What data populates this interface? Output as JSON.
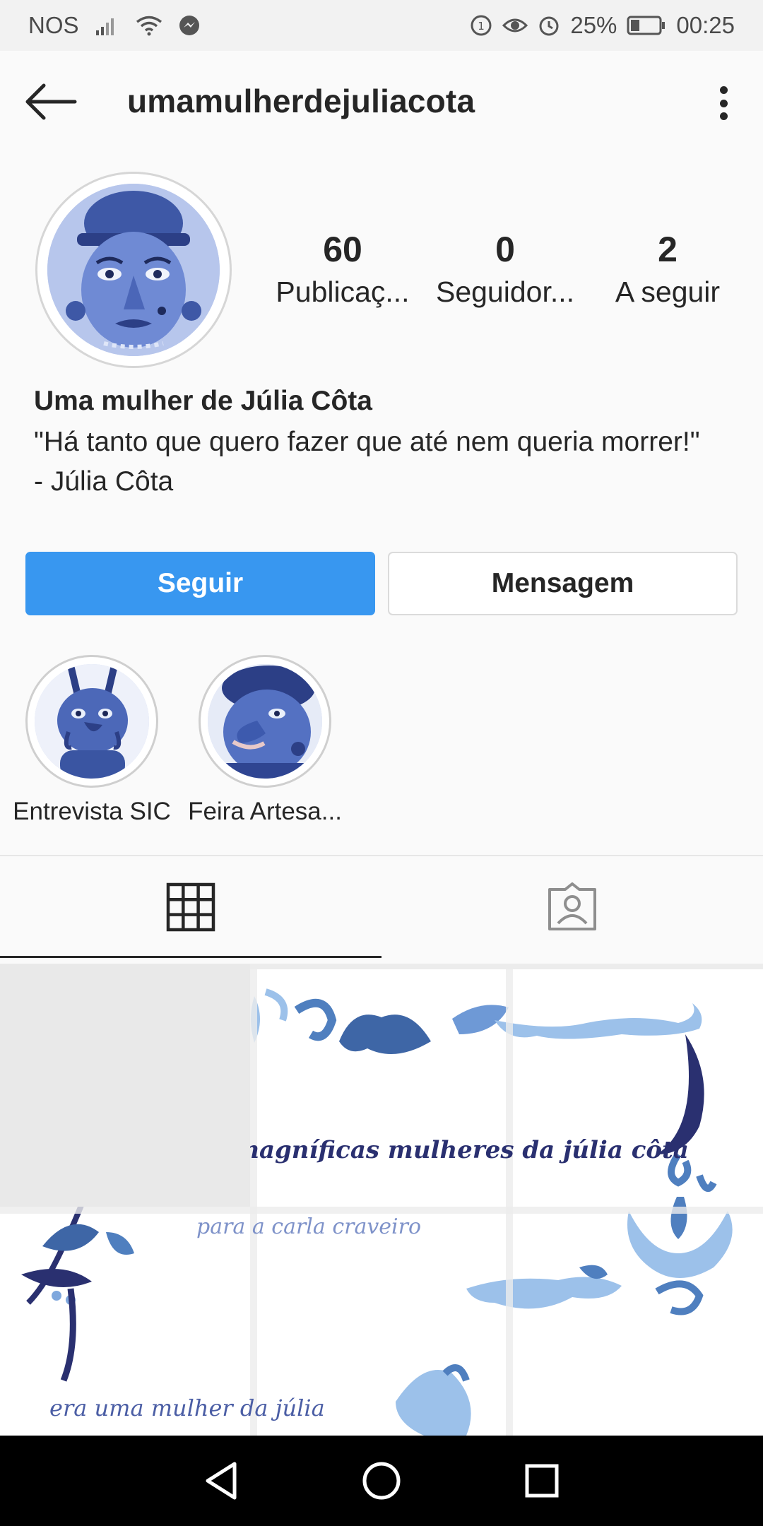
{
  "status_bar": {
    "carrier": "NOS",
    "battery": "25%",
    "time": "00:25"
  },
  "header": {
    "username": "umamulherdejuliacota"
  },
  "profile": {
    "stats": [
      {
        "value": "60",
        "label": "Publicaç..."
      },
      {
        "value": "0",
        "label": "Seguidor..."
      },
      {
        "value": "2",
        "label": "A seguir"
      }
    ],
    "name": "Uma mulher de Júlia Côta",
    "bio": "\"Há tanto que quero fazer que até nem queria morrer!\" - Júlia Côta"
  },
  "actions": {
    "follow": "Seguir",
    "message": "Mensagem"
  },
  "highlights": [
    {
      "label": "Entrevista SIC"
    },
    {
      "label": "Feira Artesa..."
    }
  ],
  "grid": {
    "text_title": "as magníficas mulheres da júlia côta",
    "text_sub": "para a carla craveiro",
    "text_bottom": "era uma mulher da júlia"
  },
  "colors": {
    "accent": "#3897f0",
    "tile_dark": "#2a3070",
    "tile_mid": "#4f7fbf",
    "tile_light": "#9cc1ea"
  }
}
